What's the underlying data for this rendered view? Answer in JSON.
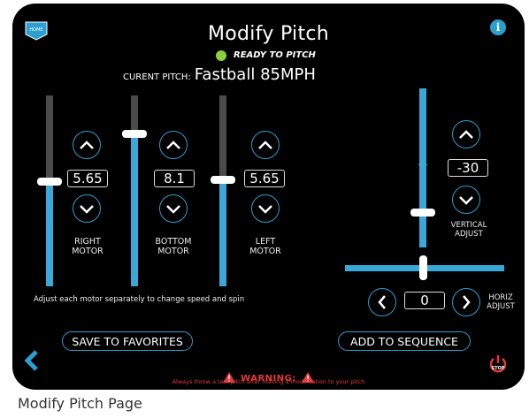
{
  "header": {
    "title": "Modify Pitch",
    "home_label": "HOME",
    "info_label": "i",
    "status_text": "READY TO PITCH",
    "status_color": "#8ccf3f"
  },
  "current_pitch": {
    "label": "CURENT PITCH:",
    "value": "Fastball 85MPH"
  },
  "motors": [
    {
      "name": "RIGHT\nMOTOR",
      "value": "5.65",
      "level": 0.55
    },
    {
      "name": "BOTTOM\nMOTOR",
      "value": "8.1",
      "level": 0.8
    },
    {
      "name": "LEFT\nMOTOR",
      "value": "5.65",
      "level": 0.56
    }
  ],
  "vertical_adjust": {
    "label": "VERTICAL\nADJUST",
    "value": "-30"
  },
  "horiz_adjust": {
    "label": "HORIZ\nADJUST",
    "value": "0"
  },
  "hint": "Adjust each motor separately to change speed and spin",
  "buttons": {
    "save_favorites": "SAVE TO FAVORITES",
    "add_sequence": "ADD TO SEQUENCE",
    "stop": "STOP"
  },
  "warning": {
    "title": "WARNING:",
    "message": "Always throw a test pitch after making a modification to your pitch"
  },
  "caption": "Modify Pitch Page",
  "colors": {
    "accent": "#2a9fd0",
    "warning": "#e23a3a",
    "background": "#000000"
  }
}
